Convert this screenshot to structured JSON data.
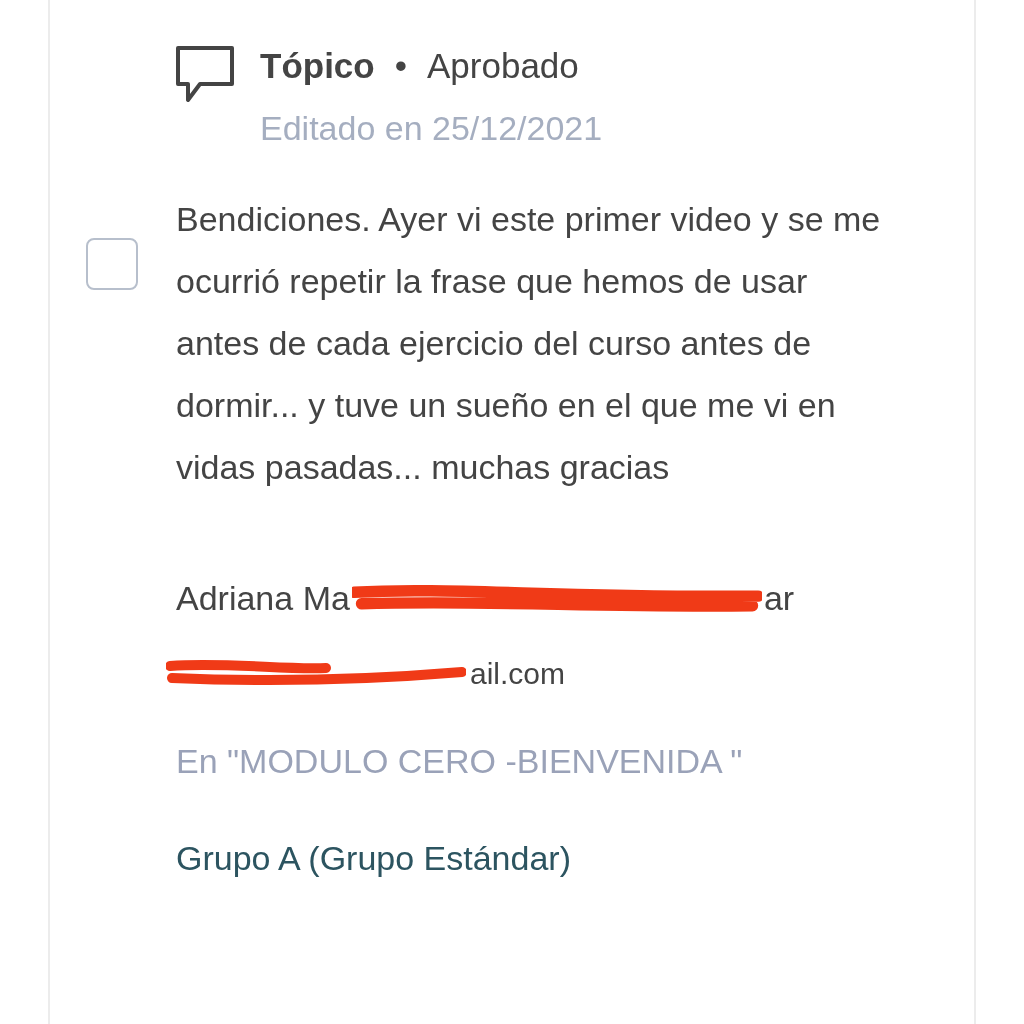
{
  "post": {
    "type": "Tópico",
    "separator": "•",
    "status": "Aprobado",
    "edited": "Editado en 25/12/2021",
    "checked": false,
    "body": "Bendiciones. Ayer vi este primer video y se me ocurrió repetir la frase que hemos de usar antes de cada ejercicio del curso antes de dormir... y tuve un sueño en el que me vi en vidas pasadas... muchas gracias",
    "author_start": "Adriana Ma",
    "author_end": "ar",
    "email_end": "ail.com",
    "module": "En \"MODULO CERO -BIENVENIDA \"",
    "group": "Grupo A (Grupo Estándar)"
  }
}
